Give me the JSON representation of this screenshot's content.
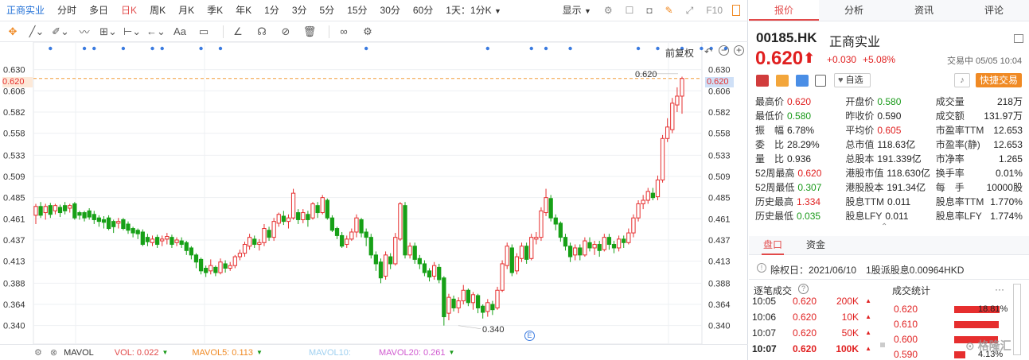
{
  "toolbar": {
    "stock_name": "正商实业",
    "timeframes": [
      "分时",
      "多日",
      "日K",
      "周K",
      "月K",
      "季K",
      "年K",
      "1分",
      "3分",
      "5分",
      "15分",
      "30分",
      "60分",
      "1天：1分K"
    ],
    "active_timeframe": "日K",
    "display_label": "显示",
    "f10_label": "F10"
  },
  "drawing_tools": [
    "crosshair-icon",
    "line-icon",
    "pen-icon",
    "wave-icon",
    "fibonacci-icon",
    "measure-icon",
    "arrow-icon",
    "text-icon",
    "comment-icon",
    "angle-icon",
    "magnet-icon",
    "hide-icon",
    "trash-icon",
    "link-icon",
    "settings-icon"
  ],
  "chart": {
    "adjust_label": "前复权",
    "y_ticks": [
      "0.630",
      "0.606",
      "0.582",
      "0.558",
      "0.533",
      "0.509",
      "0.485",
      "0.461",
      "0.437",
      "0.413",
      "0.388",
      "0.364",
      "0.340"
    ],
    "current_price_tag": "0.620",
    "max_label": "0.620",
    "min_label": "0.340",
    "e_marker": "E",
    "colors": {
      "up": "#e62e2e",
      "down": "#17a017",
      "dash": "#f29d38"
    }
  },
  "chart_data": {
    "type": "candlestick",
    "ylim": [
      0.328,
      0.636
    ],
    "y_ticks": [
      0.63,
      0.606,
      0.582,
      0.558,
      0.533,
      0.509,
      0.485,
      0.461,
      0.437,
      0.413,
      0.388,
      0.364,
      0.34
    ],
    "last_price": 0.62,
    "max": 0.62,
    "min": 0.34,
    "candles": [
      [
        0.465,
        0.475,
        0.478,
        0.455
      ],
      [
        0.475,
        0.465,
        0.48,
        0.462
      ],
      [
        0.468,
        0.475,
        0.478,
        0.46
      ],
      [
        0.476,
        0.466,
        0.479,
        0.462
      ],
      [
        0.47,
        0.476,
        0.478,
        0.466
      ],
      [
        0.474,
        0.468,
        0.477,
        0.463
      ],
      [
        0.476,
        0.47,
        0.48,
        0.466
      ],
      [
        0.473,
        0.476,
        0.478,
        0.468
      ],
      [
        0.478,
        0.462,
        0.48,
        0.46
      ],
      [
        0.468,
        0.465,
        0.47,
        0.46
      ],
      [
        0.468,
        0.462,
        0.47,
        0.458
      ],
      [
        0.47,
        0.463,
        0.473,
        0.46
      ],
      [
        0.466,
        0.46,
        0.47,
        0.455
      ],
      [
        0.462,
        0.458,
        0.465,
        0.452
      ],
      [
        0.46,
        0.457,
        0.464,
        0.45
      ],
      [
        0.462,
        0.45,
        0.465,
        0.448
      ],
      [
        0.458,
        0.452,
        0.46,
        0.445
      ],
      [
        0.456,
        0.458,
        0.462,
        0.45
      ],
      [
        0.46,
        0.45,
        0.462,
        0.448
      ],
      [
        0.455,
        0.448,
        0.458,
        0.444
      ],
      [
        0.45,
        0.445,
        0.452,
        0.44
      ],
      [
        0.448,
        0.444,
        0.45,
        0.438
      ],
      [
        0.446,
        0.432,
        0.449,
        0.43
      ],
      [
        0.44,
        0.435,
        0.444,
        0.43
      ],
      [
        0.434,
        0.438,
        0.442,
        0.43
      ],
      [
        0.44,
        0.432,
        0.443,
        0.428
      ],
      [
        0.436,
        0.438,
        0.442,
        0.43
      ],
      [
        0.438,
        0.441,
        0.445,
        0.432
      ],
      [
        0.44,
        0.432,
        0.443,
        0.428
      ],
      [
        0.434,
        0.437,
        0.44,
        0.43
      ],
      [
        0.436,
        0.432,
        0.44,
        0.428
      ],
      [
        0.434,
        0.425,
        0.436,
        0.42
      ],
      [
        0.428,
        0.42,
        0.43,
        0.415
      ],
      [
        0.42,
        0.412,
        0.422,
        0.405
      ],
      [
        0.415,
        0.402,
        0.417,
        0.398
      ],
      [
        0.405,
        0.4,
        0.408,
        0.395
      ],
      [
        0.402,
        0.408,
        0.415,
        0.398
      ],
      [
        0.406,
        0.4,
        0.408,
        0.396
      ],
      [
        0.4,
        0.412,
        0.416,
        0.398
      ],
      [
        0.41,
        0.405,
        0.414,
        0.4
      ],
      [
        0.405,
        0.408,
        0.412,
        0.402
      ],
      [
        0.408,
        0.418,
        0.42,
        0.405
      ],
      [
        0.418,
        0.422,
        0.426,
        0.414
      ],
      [
        0.422,
        0.432,
        0.435,
        0.418
      ],
      [
        0.43,
        0.44,
        0.444,
        0.426
      ],
      [
        0.438,
        0.432,
        0.442,
        0.428
      ],
      [
        0.432,
        0.434,
        0.438,
        0.425
      ],
      [
        0.434,
        0.45,
        0.455,
        0.43
      ],
      [
        0.448,
        0.44,
        0.452,
        0.436
      ],
      [
        0.44,
        0.458,
        0.462,
        0.436
      ],
      [
        0.456,
        0.466,
        0.468,
        0.452
      ],
      [
        0.464,
        0.458,
        0.47,
        0.454
      ],
      [
        0.458,
        0.462,
        0.466,
        0.45
      ],
      [
        0.462,
        0.49,
        0.495,
        0.46
      ],
      [
        0.468,
        0.46,
        0.472,
        0.455
      ],
      [
        0.46,
        0.468,
        0.472,
        0.456
      ],
      [
        0.466,
        0.46,
        0.47,
        0.452
      ],
      [
        0.462,
        0.478,
        0.48,
        0.46
      ],
      [
        0.476,
        0.468,
        0.48,
        0.462
      ],
      [
        0.468,
        0.485,
        0.488,
        0.466
      ],
      [
        0.482,
        0.462,
        0.484,
        0.46
      ],
      [
        0.462,
        0.448,
        0.465,
        0.446
      ],
      [
        0.45,
        0.442,
        0.452,
        0.438
      ],
      [
        0.442,
        0.43,
        0.446,
        0.428
      ],
      [
        0.432,
        0.438,
        0.442,
        0.428
      ],
      [
        0.438,
        0.446,
        0.45,
        0.436
      ],
      [
        0.446,
        0.462,
        0.466,
        0.44
      ],
      [
        0.46,
        0.445,
        0.462,
        0.44
      ],
      [
        0.446,
        0.44,
        0.45,
        0.43
      ],
      [
        0.44,
        0.42,
        0.444,
        0.416
      ],
      [
        0.42,
        0.41,
        0.424,
        0.402
      ],
      [
        0.412,
        0.394,
        0.416,
        0.388
      ],
      [
        0.396,
        0.42,
        0.424,
        0.392
      ],
      [
        0.418,
        0.41,
        0.422,
        0.404
      ],
      [
        0.41,
        0.44,
        0.445,
        0.408
      ],
      [
        0.438,
        0.478,
        0.48,
        0.436
      ],
      [
        0.476,
        0.42,
        0.48,
        0.416
      ],
      [
        0.42,
        0.43,
        0.434,
        0.416
      ],
      [
        0.43,
        0.415,
        0.434,
        0.41
      ],
      [
        0.416,
        0.41,
        0.42,
        0.404
      ],
      [
        0.41,
        0.4,
        0.414,
        0.396
      ],
      [
        0.402,
        0.395,
        0.405,
        0.39
      ],
      [
        0.396,
        0.408,
        0.412,
        0.392
      ],
      [
        0.406,
        0.392,
        0.41,
        0.388
      ],
      [
        0.394,
        0.35,
        0.396,
        0.34
      ],
      [
        0.354,
        0.372,
        0.376,
        0.346
      ],
      [
        0.37,
        0.36,
        0.374,
        0.356
      ],
      [
        0.36,
        0.368,
        0.372,
        0.354
      ],
      [
        0.368,
        0.38,
        0.386,
        0.364
      ],
      [
        0.38,
        0.366,
        0.382,
        0.362
      ],
      [
        0.366,
        0.375,
        0.378,
        0.358
      ],
      [
        0.374,
        0.36,
        0.376,
        0.354
      ],
      [
        0.362,
        0.355,
        0.364,
        0.348
      ],
      [
        0.356,
        0.366,
        0.37,
        0.35
      ],
      [
        0.364,
        0.358,
        0.368,
        0.352
      ],
      [
        0.36,
        0.38,
        0.384,
        0.358
      ],
      [
        0.38,
        0.41,
        0.414,
        0.378
      ],
      [
        0.408,
        0.43,
        0.434,
        0.404
      ],
      [
        0.428,
        0.4,
        0.432,
        0.396
      ],
      [
        0.402,
        0.418,
        0.422,
        0.398
      ],
      [
        0.416,
        0.43,
        0.434,
        0.412
      ],
      [
        0.43,
        0.415,
        0.434,
        0.41
      ],
      [
        0.416,
        0.44,
        0.444,
        0.414
      ],
      [
        0.438,
        0.44,
        0.446,
        0.432
      ],
      [
        0.44,
        0.47,
        0.474,
        0.436
      ],
      [
        0.468,
        0.485,
        0.495,
        0.464
      ],
      [
        0.484,
        0.462,
        0.488,
        0.458
      ],
      [
        0.462,
        0.455,
        0.466,
        0.448
      ],
      [
        0.456,
        0.44,
        0.458,
        0.435
      ],
      [
        0.44,
        0.43,
        0.444,
        0.425
      ],
      [
        0.43,
        0.418,
        0.434,
        0.412
      ],
      [
        0.42,
        0.428,
        0.432,
        0.414
      ],
      [
        0.428,
        0.42,
        0.432,
        0.414
      ],
      [
        0.42,
        0.436,
        0.44,
        0.418
      ],
      [
        0.434,
        0.428,
        0.44,
        0.424
      ],
      [
        0.428,
        0.432,
        0.436,
        0.42
      ],
      [
        0.432,
        0.425,
        0.436,
        0.418
      ],
      [
        0.426,
        0.44,
        0.444,
        0.424
      ],
      [
        0.44,
        0.432,
        0.444,
        0.426
      ],
      [
        0.432,
        0.428,
        0.436,
        0.422
      ],
      [
        0.428,
        0.438,
        0.442,
        0.424
      ],
      [
        0.438,
        0.434,
        0.442,
        0.428
      ],
      [
        0.434,
        0.445,
        0.45,
        0.432
      ],
      [
        0.445,
        0.462,
        0.466,
        0.44
      ],
      [
        0.462,
        0.478,
        0.482,
        0.458
      ],
      [
        0.478,
        0.482,
        0.488,
        0.472
      ],
      [
        0.482,
        0.492,
        0.496,
        0.478
      ],
      [
        0.49,
        0.485,
        0.496,
        0.482
      ],
      [
        0.486,
        0.505,
        0.51,
        0.482
      ],
      [
        0.505,
        0.552,
        0.556,
        0.502
      ],
      [
        0.552,
        0.565,
        0.575,
        0.548
      ],
      [
        0.562,
        0.592,
        0.598,
        0.558
      ],
      [
        0.59,
        0.6,
        0.61,
        0.582
      ],
      [
        0.6,
        0.62,
        0.622,
        0.58
      ]
    ],
    "event_dots_x_index": [
      3,
      10,
      12,
      18,
      24,
      26,
      34,
      38,
      68,
      93,
      102,
      105,
      110,
      124,
      128,
      133,
      137,
      139,
      142
    ]
  },
  "bottom_bar": {
    "indicator": "MAVOL",
    "vol": "VOL: 0.022",
    "mavol5": "MAVOL5: 0.113",
    "mavol10": "MAVOL10:",
    "mavol20": "MAVOL20: 0.261"
  },
  "right_tabs": [
    "报价",
    "分析",
    "资讯",
    "评论"
  ],
  "quote": {
    "code": "00185.HK",
    "name": "正商实业",
    "price": "0.620",
    "change": "+0.030",
    "change_pct": "+5.08%",
    "status": "交易中 05/05 10:04",
    "watch_label": "自选",
    "fast_trade": "快捷交易",
    "rows": [
      [
        [
          "最高价",
          "0.620",
          "red"
        ],
        [
          "开盘价",
          "0.580",
          "green"
        ],
        [
          "成交量",
          "218万",
          "blk"
        ]
      ],
      [
        [
          "最低价",
          "0.580",
          "green"
        ],
        [
          "昨收价",
          "0.590",
          "blk"
        ],
        [
          "成交额",
          "131.97万",
          "blk"
        ]
      ],
      [
        [
          "振　幅",
          "6.78%",
          "blk"
        ],
        [
          "平均价",
          "0.605",
          "red"
        ],
        [
          "市盈率TTM",
          "12.653",
          "blk"
        ]
      ],
      [
        [
          "委　比",
          "28.29%",
          "blk"
        ],
        [
          "总市值",
          "118.63亿",
          "blk"
        ],
        [
          "市盈率(静)",
          "12.653",
          "blk"
        ]
      ],
      [
        [
          "量　比",
          "0.936",
          "blk"
        ],
        [
          "总股本",
          "191.339亿",
          "blk"
        ],
        [
          "市净率",
          "1.265",
          "blk"
        ]
      ],
      [
        [
          "52周最高",
          "0.620",
          "red"
        ],
        [
          "港股市值",
          "118.630亿",
          "blk"
        ],
        [
          "换手率",
          "0.01%",
          "blk"
        ]
      ],
      [
        [
          "52周最低",
          "0.307",
          "green"
        ],
        [
          "港股股本",
          "191.34亿",
          "blk"
        ],
        [
          "每　手",
          "10000股",
          "blk"
        ]
      ],
      [
        [
          "历史最高",
          "1.334",
          "red"
        ],
        [
          "股息TTM",
          "0.011",
          "blk"
        ],
        [
          "股息率TTM",
          "1.770%",
          "blk"
        ]
      ],
      [
        [
          "历史最低",
          "0.035",
          "green"
        ],
        [
          "股息LFY",
          "0.011",
          "blk"
        ],
        [
          "股息率LFY",
          "1.774%",
          "blk"
        ]
      ]
    ]
  },
  "section_tabs": [
    "盘口",
    "资金"
  ],
  "dividend_note": "除权日：2021/06/10　1股派股息0.00964HKD",
  "trades": {
    "title": "逐笔成交",
    "rows": [
      [
        "10:05",
        "0.620",
        "200K"
      ],
      [
        "10:06",
        "0.620",
        "10K"
      ],
      [
        "10:07",
        "0.620",
        "50K"
      ],
      [
        "10:07",
        "0.620",
        "100K"
      ]
    ]
  },
  "stats": {
    "title": "成交统计",
    "rows": [
      [
        "0.620",
        "18.81%",
        0.82
      ],
      [
        "0.610",
        "",
        0.8
      ],
      [
        "0.600",
        "",
        0.78
      ],
      [
        "0.590",
        "4.13%",
        0.2
      ]
    ]
  },
  "watermark": "格隆汇"
}
